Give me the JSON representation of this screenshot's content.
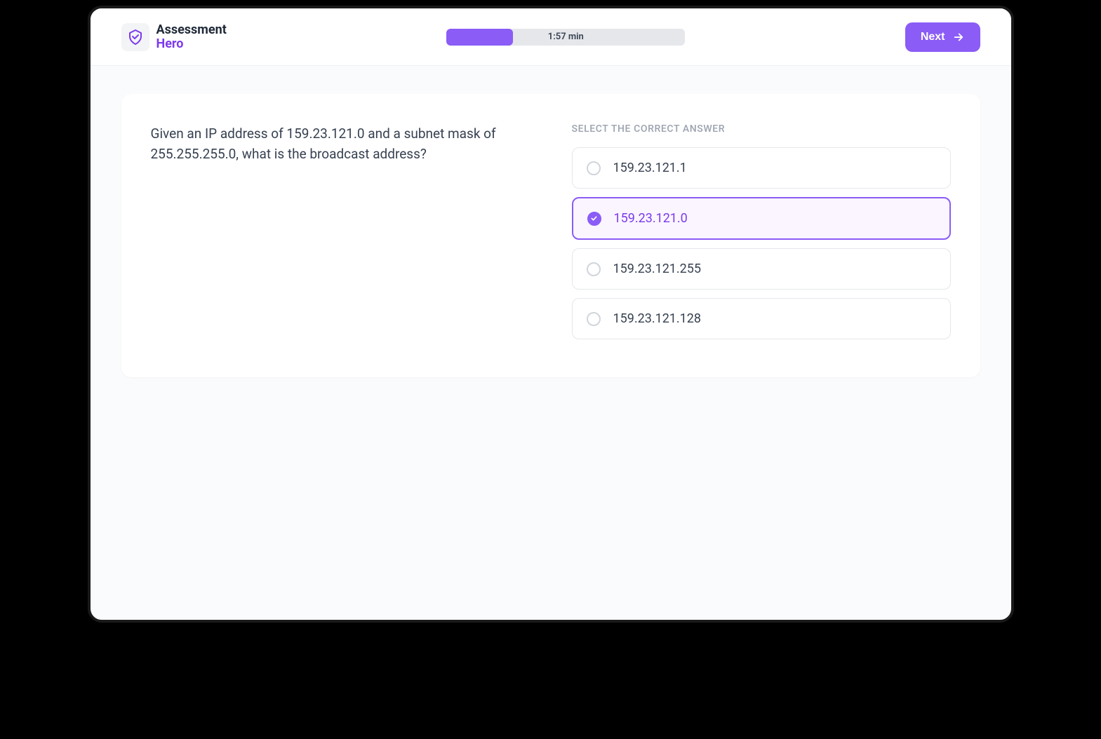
{
  "header": {
    "brand_line1": "Assessment",
    "brand_line2": "Hero",
    "timer": "1:57 min",
    "progress_percent": 28,
    "next_label": "Next"
  },
  "question": {
    "text": "Given an IP address of 159.23.121.0 and a subnet mask of 255.255.255.0, what is the broadcast address?",
    "instruction": "SELECT THE CORRECT ANSWER"
  },
  "options": [
    {
      "label": "159.23.121.1",
      "selected": false
    },
    {
      "label": "159.23.121.0",
      "selected": true
    },
    {
      "label": "159.23.121.255",
      "selected": false
    },
    {
      "label": "159.23.121.128",
      "selected": false
    }
  ]
}
